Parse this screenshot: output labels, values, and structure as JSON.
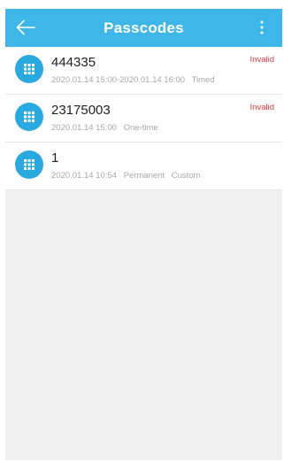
{
  "header": {
    "title": "Passcodes",
    "back_icon": "arrow-left-icon",
    "menu_icon": "more-vertical-icon"
  },
  "passcodes": [
    {
      "code": "444335",
      "time": "2020.01.14 15:00-2020.01.14 16:00",
      "type": "Timed",
      "extra": "",
      "status": "Invalid"
    },
    {
      "code": "23175003",
      "time": "2020.01.14 15:00",
      "type": "One-time",
      "extra": "",
      "status": "Invalid"
    },
    {
      "code": "1",
      "time": "2020.01.14 10:54",
      "type": "Permanent",
      "extra": "Custom",
      "status": ""
    }
  ],
  "colors": {
    "accent": "#3fb6e8",
    "avatar": "#2aa9e0",
    "invalid": "#e0393e",
    "background": "#efefef"
  }
}
